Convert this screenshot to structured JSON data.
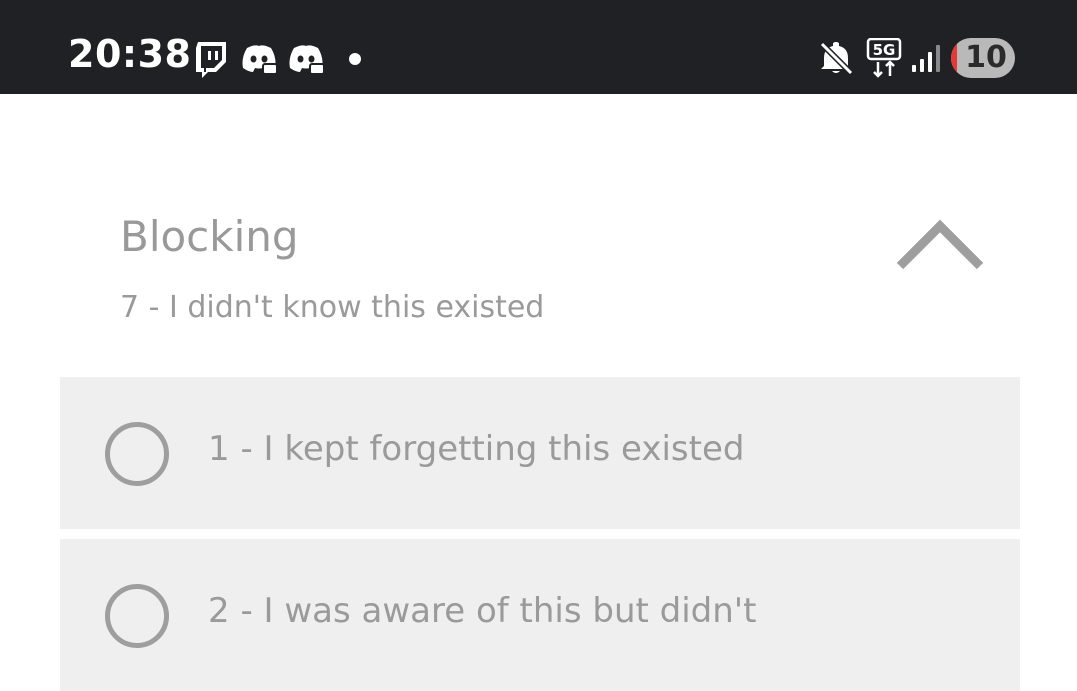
{
  "status_bar": {
    "time": "20:38",
    "icons": [
      "twitch-icon",
      "discord-icon",
      "discord-icon",
      "notification-dot",
      "mute-icon",
      "5g-icon",
      "signal-icon"
    ],
    "network": "5G",
    "battery_level": "10",
    "battery_fraction": 0.1,
    "battery_color": "#e53935"
  },
  "question": {
    "title": "Blocking",
    "selected_answer": "7 - I didn't know this existed",
    "collapse_icon": "chevron-up-icon"
  },
  "options": [
    {
      "label": "1 - I kept forgetting this existed",
      "selected": false
    },
    {
      "label": "2 - I was aware of this but didn't",
      "selected": false
    }
  ],
  "colors": {
    "status_bar_bg": "#202125",
    "option_bg": "#efefef",
    "muted_text": "#999999"
  }
}
